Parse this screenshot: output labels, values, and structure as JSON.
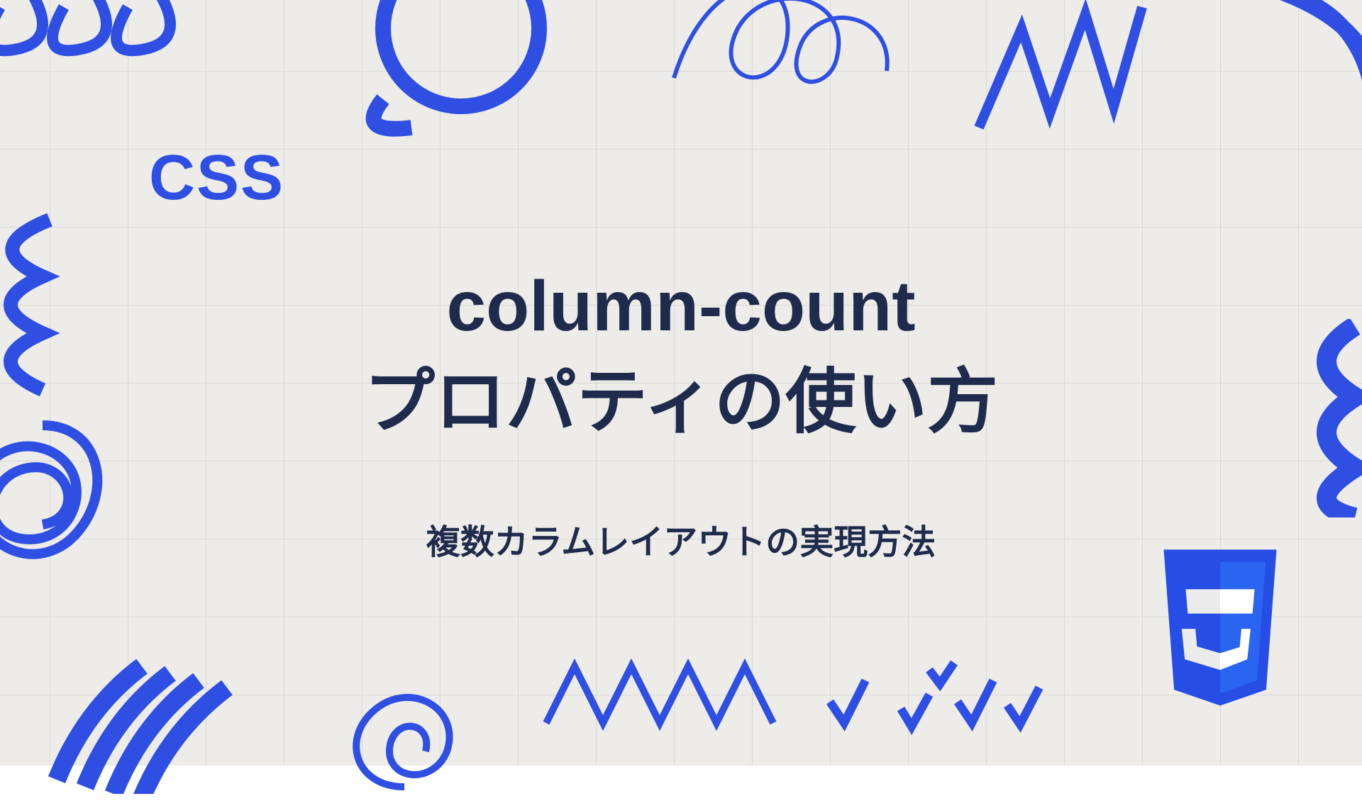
{
  "category_label": "CSS",
  "title_line1": "column-count",
  "title_line2": "プロパティの使い方",
  "subtitle": "複数カラムレイアウトの実現方法",
  "colors": {
    "accent": "#2f4fe3",
    "text": "#1f2b4c",
    "paper": "#edece8",
    "grid": "#d9d8d4"
  },
  "badge": {
    "name": "CSS3",
    "digit": "3"
  }
}
